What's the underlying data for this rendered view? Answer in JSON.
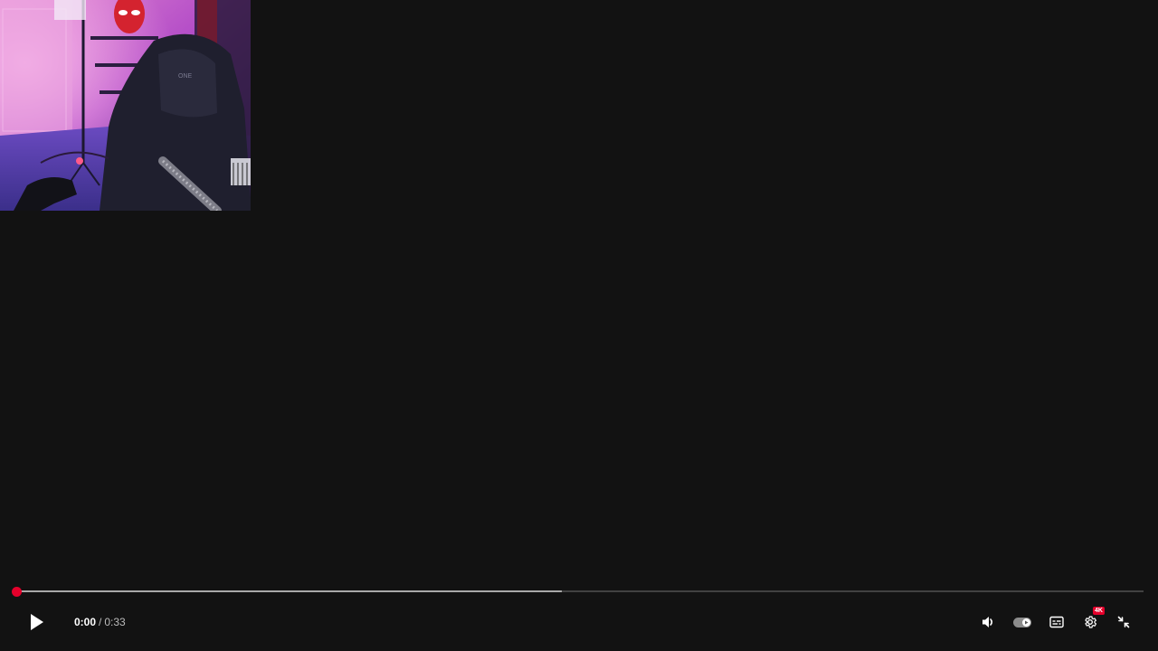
{
  "player": {
    "progress": {
      "played_fraction": 0.0,
      "buffered_fraction": 0.484,
      "accent_color": "#e5002b"
    },
    "time": {
      "current": "0:00",
      "separator": "/",
      "duration": "0:33"
    },
    "controls": {
      "play_icon": "play-icon",
      "volume_icon": "volume-icon",
      "autoplay_icon": "autoplay-toggle-icon",
      "subtitles_icon": "subtitles-icon",
      "settings_icon": "settings-icon",
      "quality_badge": "4K",
      "exit_fullscreen_icon": "exit-fullscreen-icon"
    }
  }
}
